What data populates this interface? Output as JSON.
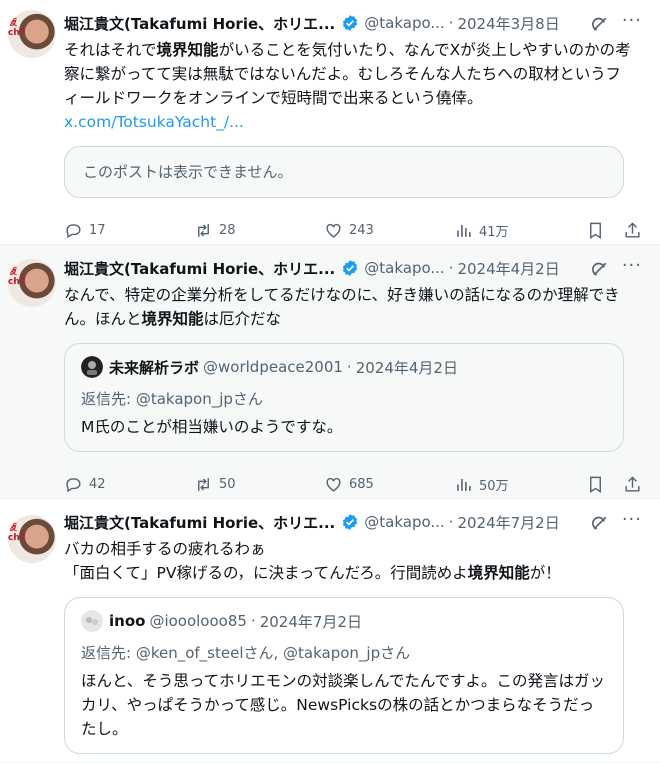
{
  "tweets": [
    {
      "author": "堀江貴文(Takafumi Horie、ホリエ...",
      "handle": "@takapo...",
      "date": "2024年3月8日",
      "avatar_caption": "疲ch?",
      "text_parts": [
        "それはそれで",
        "境界知能",
        "がいることを気付いたり、なんでXが炎上しやすいのかの考察に繋がってて実は無駄ではないんだよ。むしろそんな人たちへの取材というフィールドワークをオンラインで短時間で出来るという僥倖。"
      ],
      "link": "x.com/TotsukaYacht_/...",
      "hidden_card": "このポストは表示できません。",
      "stats": {
        "replies": "17",
        "reposts": "28",
        "likes": "243",
        "views": "41万"
      }
    },
    {
      "author": "堀江貴文(Takafumi Horie、ホリエ...",
      "handle": "@takapo...",
      "date": "2024年4月2日",
      "avatar_caption": "疲ch?",
      "text_parts": [
        "なんで、特定の企業分析をしてるだけなのに、好き嫌いの話になるのか理解できん。ほんと",
        "境界知能",
        "は厄介だな"
      ],
      "quote": {
        "name": "未来解析ラボ",
        "handle": "@worldpeace2001",
        "date": "2024年4月2日",
        "reply_to": "返信先: @takapon_jpさん",
        "text": "M氏のことが相当嫌いのようですな。"
      },
      "stats": {
        "replies": "42",
        "reposts": "50",
        "likes": "685",
        "views": "50万"
      }
    },
    {
      "author": "堀江貴文(Takafumi Horie、ホリエ...",
      "handle": "@takapo...",
      "date": "2024年7月2日",
      "avatar_caption": "疲ch?",
      "text_parts": [
        "バカの相手するの疲れるわぁ\n「面白くて」PV稼げるの，に決まってんだろ。行間読めよ",
        "境界知能",
        "が！"
      ],
      "quote": {
        "name": "inoo",
        "handle": "@iooolooo85",
        "date": "2024年7月2日",
        "reply_to": "返信先: @ken_of_steelさん, @takapon_jpさん",
        "text": "ほんと、そう思ってホリエモンの対談楽しんでたんですよ。この発言はガッカリ、やっぱそうかって感じ。NewsPicksの株の話とかつまらなそうだったし。"
      }
    }
  ],
  "separator": "·",
  "colors": {
    "verified": "#1d9bf0",
    "link": "#1d9bf0",
    "muted": "#536471"
  },
  "icons": [
    "verified-badge-icon",
    "grok-icon",
    "more-icon",
    "reply-icon",
    "repost-icon",
    "like-icon",
    "views-icon",
    "bookmark-icon",
    "share-icon"
  ]
}
